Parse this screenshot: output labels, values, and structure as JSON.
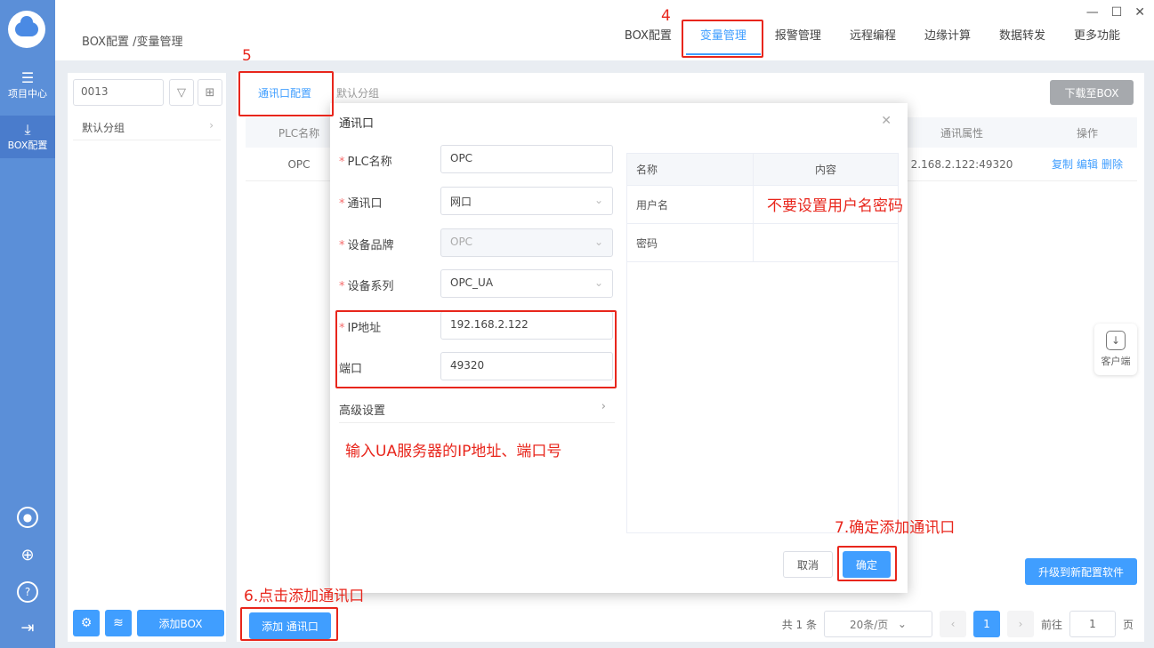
{
  "rail": {
    "items": [
      {
        "label": "项目中心",
        "icon": "grid-icon"
      },
      {
        "label": "BOX配置",
        "icon": "download-icon"
      }
    ]
  },
  "header": {
    "breadcrumb": "BOX配置 /变量管理",
    "nav": [
      "BOX配置",
      "变量管理",
      "报警管理",
      "远程编程",
      "边缘计算",
      "数据转发",
      "更多功能"
    ],
    "active_nav": "变量管理"
  },
  "left_panel": {
    "search_value": "0013",
    "group": "默认分组",
    "add_box": "添加BOX"
  },
  "main": {
    "tabs": [
      "通讯口配置",
      "默认分组"
    ],
    "download": "下载至BOX",
    "columns": {
      "plc_name": "PLC名称",
      "comm_attr": "通讯属性",
      "actions": "操作"
    },
    "row": {
      "plc_name": "OPC",
      "comm_attr": "2.168.2.122:49320",
      "copy": "复制",
      "edit": "编辑",
      "delete": "删除"
    },
    "upgrade": "升级到新配置软件",
    "add_port": "添加 通讯口"
  },
  "pagination": {
    "total": "共 1 条",
    "page_size": "20条/页",
    "current_page": "1",
    "goto_label": "前往",
    "goto_value": "1",
    "page_suffix": "页"
  },
  "client": "客户端",
  "modal": {
    "title": "通讯口",
    "fields": {
      "plc_name": {
        "label": "PLC名称",
        "value": "OPC"
      },
      "port_type": {
        "label": "通讯口",
        "value": "网口"
      },
      "brand": {
        "label": "设备品牌",
        "value": "OPC"
      },
      "series": {
        "label": "设备系列",
        "value": "OPC_UA"
      },
      "ip": {
        "label": "IP地址",
        "value": "192.168.2.122"
      },
      "port": {
        "label": "端口",
        "value": "49320"
      }
    },
    "advanced": "高级设置",
    "table": {
      "col_name": "名称",
      "col_content": "内容",
      "rows": [
        "用户名",
        "密码"
      ]
    },
    "cancel": "取消",
    "confirm": "确定"
  },
  "annotations": {
    "step4": "4",
    "step5": "5",
    "step6": "6.点击添加通讯口",
    "step7": "7.确定添加通讯口",
    "ip_note": "输入UA服务器的IP地址、端口号",
    "password_note": "不要设置用户名密码",
    "color": "#e8261c"
  }
}
